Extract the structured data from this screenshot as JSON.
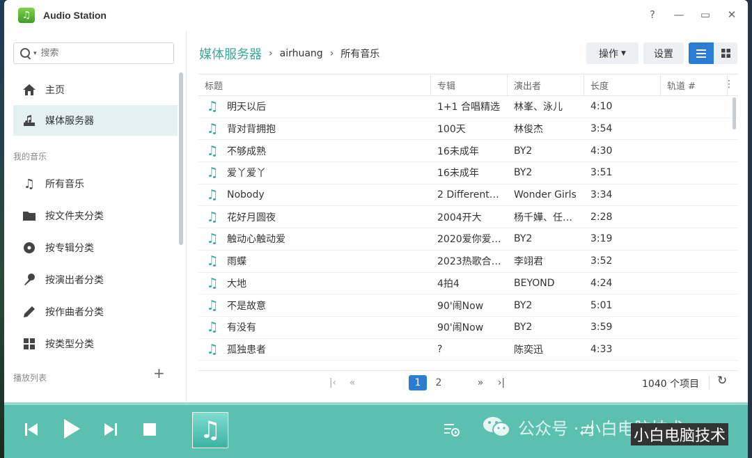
{
  "window": {
    "title": "Audio Station",
    "help": "?",
    "minimize": "—",
    "maximize": "▭",
    "close": "✕"
  },
  "sidebar": {
    "search_placeholder": "搜索",
    "items": [
      {
        "label": "主页",
        "icon": "home-icon"
      },
      {
        "label": "媒体服务器",
        "icon": "media-server-icon"
      }
    ],
    "my_music_label": "我的音乐",
    "music_items": [
      {
        "label": "所有音乐",
        "icon": "music-note-icon"
      },
      {
        "label": "按文件夹分类",
        "icon": "folder-icon"
      },
      {
        "label": "按专辑分类",
        "icon": "album-icon"
      },
      {
        "label": "按演出者分类",
        "icon": "microphone-icon"
      },
      {
        "label": "按作曲者分类",
        "icon": "pen-icon"
      },
      {
        "label": "按类型分类",
        "icon": "genre-icon"
      }
    ],
    "playlist_label": "播放列表",
    "add_label": "+"
  },
  "breadcrumb": {
    "root": "媒体服务器",
    "user": "airhuang",
    "current": "所有音乐"
  },
  "toolbar": {
    "ops_label": "操作",
    "settings_label": "设置"
  },
  "table": {
    "headers": [
      "标题",
      "专辑",
      "演出者",
      "长度",
      "轨道 #"
    ],
    "rows": [
      {
        "title": "明天以后",
        "album": "1+1 合唱精选",
        "artist": "林峯、泳儿",
        "length": "4:10",
        "track": ""
      },
      {
        "title": "背对背拥抱",
        "album": "100天",
        "artist": "林俊杰",
        "length": "3:54",
        "track": ""
      },
      {
        "title": "不够成熟",
        "album": "16未成年",
        "artist": "BY2",
        "length": "4:30",
        "track": ""
      },
      {
        "title": "爱丫爱丫",
        "album": "16未成年",
        "artist": "BY2",
        "length": "3:51",
        "track": ""
      },
      {
        "title": "Nobody",
        "album": "2 Different…",
        "artist": "Wonder Girls",
        "length": "3:34",
        "track": ""
      },
      {
        "title": "花好月圆夜",
        "album": "2004开大",
        "artist": "杨千嬅、任…",
        "length": "2:28",
        "track": ""
      },
      {
        "title": "触动心触动爱",
        "album": "2020爱你爱…",
        "artist": "BY2",
        "length": "3:19",
        "track": ""
      },
      {
        "title": "雨蝶",
        "album": "2023热歌合…",
        "artist": "李翊君",
        "length": "3:52",
        "track": ""
      },
      {
        "title": "大地",
        "album": "4拍4",
        "artist": "BEYOND",
        "length": "4:24",
        "track": ""
      },
      {
        "title": "不是故意",
        "album": "90'闹Now",
        "artist": "BY2",
        "length": "5:01",
        "track": ""
      },
      {
        "title": "有没有",
        "album": "90'闹Now",
        "artist": "BY2",
        "length": "3:59",
        "track": ""
      },
      {
        "title": "孤独患者",
        "album": "?",
        "artist": "陈奕迅",
        "length": "4:33",
        "track": ""
      }
    ]
  },
  "pager": {
    "page1": "1",
    "page2": "2",
    "total": "1040 个项目"
  },
  "watermark": {
    "text": "公众号 · 小白电脑技术",
    "badge": "小白电脑技术"
  },
  "colors": {
    "accent": "#3aa99a",
    "primary_button": "#2a7cd5",
    "player_bg": "#5cc0b0"
  }
}
